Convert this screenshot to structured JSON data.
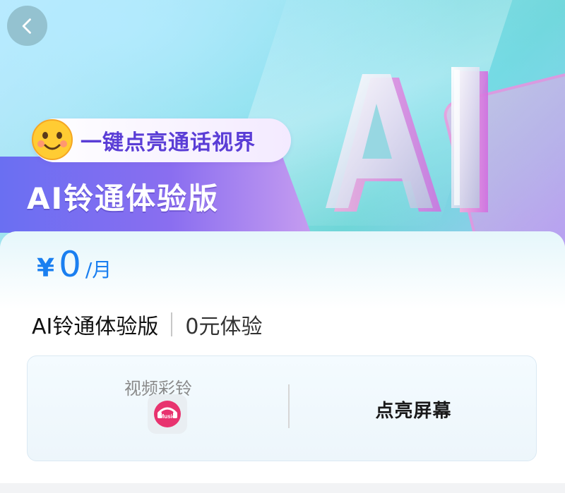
{
  "hero": {
    "slogan": "一键点亮通话视界",
    "title": "AI铃通体验版",
    "decor_text": "AI"
  },
  "price": {
    "currency_symbol": "¥",
    "amount": "0",
    "unit": "/月"
  },
  "plan": {
    "name": "AI铃通体验版",
    "subtitle": "0元体验"
  },
  "feature": {
    "left_label": "视频彩铃",
    "icon_text": "Music",
    "right_label": "点亮屏幕"
  },
  "colors": {
    "accent_blue": "#1a7ff0",
    "title_purple": "#6a6ff2",
    "slogan_purple": "#5a3dd6",
    "music_pink": "#e8336f"
  },
  "icons": {
    "back": "chevron-left-icon",
    "emoji": "smiling-face-icon",
    "music": "music-app-icon"
  }
}
